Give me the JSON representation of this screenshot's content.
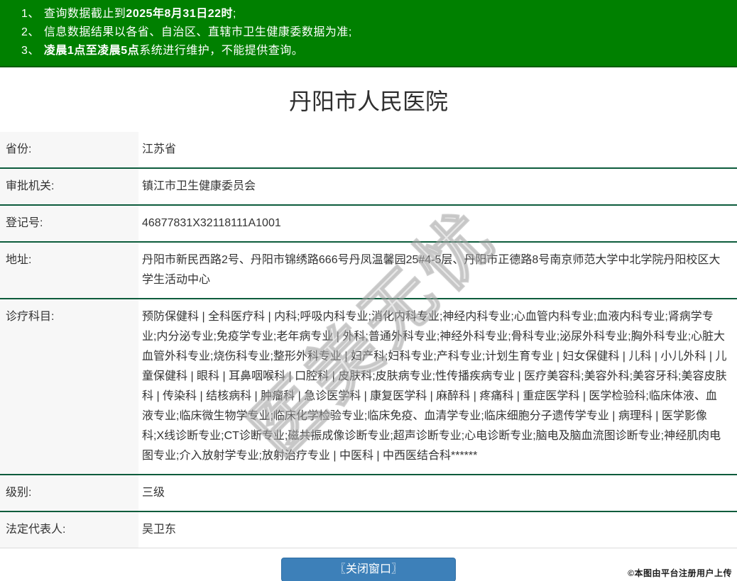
{
  "notice": {
    "items": [
      {
        "num": "1、",
        "pre": "查询数据截止到",
        "bold": "2025年8月31日22时",
        "post": ";"
      },
      {
        "num": "2、",
        "pre": "信息数据结果以各省、自治区、直辖市卫生健康委数据为准;",
        "bold": "",
        "post": ""
      },
      {
        "num": "3、",
        "pre": "",
        "bold": "凌晨1点至凌晨5点",
        "post": "系统进行维护，不能提供查询。"
      }
    ]
  },
  "page": {
    "title": "丹阳市人民医院"
  },
  "table": {
    "rows": [
      {
        "label": "省份:",
        "value": "江苏省"
      },
      {
        "label": "审批机关:",
        "value": "镇江市卫生健康委员会"
      },
      {
        "label": "登记号:",
        "value": "46877831X32118111A1001"
      },
      {
        "label": "地址:",
        "value": "丹阳市新民西路2号、丹阳市锦绣路666号丹凤温馨园25#4-5层、丹阳市正德路8号南京师范大学中北学院丹阳校区大学生活动中心"
      },
      {
        "label": "诊疗科目:",
        "value": "预防保健科 | 全科医疗科 | 内科;呼吸内科专业;消化内科专业;神经内科专业;心血管内科专业;血液内科专业;肾病学专业;内分泌专业;免疫学专业;老年病专业 | 外科;普通外科专业;神经外科专业;骨科专业;泌尿外科专业;胸外科专业;心脏大血管外科专业;烧伤科专业;整形外科专业 | 妇产科;妇科专业;产科专业;计划生育专业 | 妇女保健科 | 儿科 | 小儿外科 | 儿童保健科 | 眼科 | 耳鼻咽喉科 | 口腔科 | 皮肤科;皮肤病专业;性传播疾病专业 | 医疗美容科;美容外科;美容牙科;美容皮肤科 | 传染科 | 结核病科 | 肿瘤科 | 急诊医学科 | 康复医学科 | 麻醉科 | 疼痛科 | 重症医学科 | 医学检验科;临床体液、血液专业;临床微生物学专业;临床化学检验专业;临床免疫、血清学专业;临床细胞分子遗传学专业 | 病理科 | 医学影像科;X线诊断专业;CT诊断专业;磁共振成像诊断专业;超声诊断专业;心电诊断专业;脑电及脑血流图诊断专业;神经肌肉电图专业;介入放射学专业;放射治疗专业 | 中医科 | 中西医结合科******"
      },
      {
        "label": "级别:",
        "value": "三级"
      },
      {
        "label": "法定代表人:",
        "value": "吴卫东"
      }
    ]
  },
  "watermark": {
    "text": "医美无忧"
  },
  "footer": {
    "close_button": "〖关闭窗口〗",
    "credit": "©本图由平台注册用户上传"
  },
  "colors": {
    "banner_green": "#008000",
    "separator_green": "#0d5c3c",
    "button_blue": "#3d80b9",
    "label_bg": "#f7f7f7"
  }
}
